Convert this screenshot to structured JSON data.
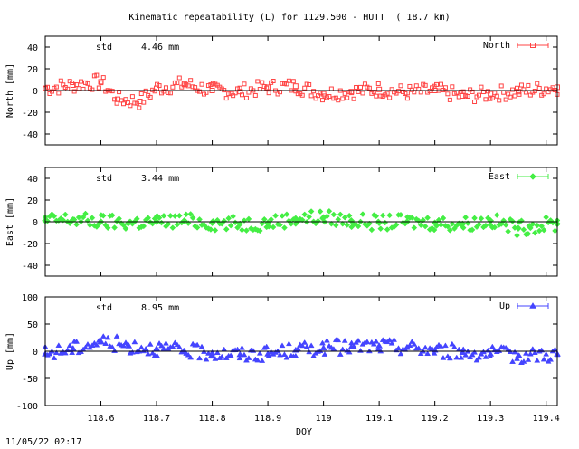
{
  "title": "Kinematic repeatability (L) for 1129.500 - HUTT  ( 18.7 km)",
  "footer_timestamp": "11/05/22 02:17",
  "chart_data": [
    {
      "type": "scatter",
      "series_name": "North",
      "ylabel": "North [mm]",
      "ylim": [
        -50,
        50
      ],
      "yticks": [
        -40,
        -20,
        0,
        20,
        40
      ],
      "std_label": "std",
      "std_value": "4.46 mm",
      "color": "#ff4444",
      "marker": "square",
      "xlim": [
        118.5,
        119.42
      ],
      "x": [
        118.5,
        118.55,
        118.6,
        118.63,
        118.67,
        118.7,
        118.75,
        118.8,
        118.85,
        118.9,
        118.95,
        119.0,
        119.05,
        119.1,
        119.15,
        119.2,
        119.25,
        119.3,
        119.35,
        119.42
      ],
      "y": [
        2,
        5,
        8,
        -8,
        -10,
        2,
        6,
        0,
        -1,
        3,
        4,
        -3,
        -1,
        1,
        -2,
        0,
        -5,
        -3,
        -1,
        3
      ]
    },
    {
      "type": "scatter",
      "series_name": "East",
      "ylabel": "East [mm]",
      "ylim": [
        -50,
        50
      ],
      "yticks": [
        -40,
        -20,
        0,
        20,
        40
      ],
      "std_label": "std",
      "std_value": "3.44 mm",
      "color": "#44ee44",
      "marker": "diamond",
      "xlim": [
        118.5,
        119.42
      ],
      "x": [
        118.5,
        118.55,
        118.6,
        118.65,
        118.7,
        118.75,
        118.8,
        118.85,
        118.9,
        118.95,
        119.0,
        119.05,
        119.1,
        119.15,
        119.2,
        119.25,
        119.3,
        119.35,
        119.37,
        119.42
      ],
      "y": [
        1,
        2,
        0,
        -1,
        0,
        1,
        -1,
        -2,
        -1,
        3,
        4,
        1,
        -1,
        0,
        -1,
        -2,
        1,
        -6,
        -4,
        -2
      ]
    },
    {
      "type": "scatter",
      "series_name": "Up",
      "ylabel": "Up [mm]",
      "ylim": [
        -100,
        100
      ],
      "yticks": [
        -100,
        -50,
        0,
        50,
        100
      ],
      "std_label": "std",
      "std_value": "8.95 mm",
      "color": "#4444ff",
      "marker": "triangle",
      "xlim": [
        118.5,
        119.42
      ],
      "x": [
        118.5,
        118.55,
        118.6,
        118.65,
        118.7,
        118.75,
        118.8,
        118.85,
        118.9,
        118.95,
        119.0,
        119.05,
        119.1,
        119.15,
        119.2,
        119.25,
        119.3,
        119.35,
        119.42
      ],
      "y": [
        -5,
        5,
        18,
        10,
        5,
        0,
        -3,
        -6,
        -5,
        2,
        6,
        8,
        10,
        7,
        2,
        -2,
        -5,
        -8,
        -5
      ],
      "xlabel": "DOY",
      "xticks": [
        118.6,
        118.7,
        118.8,
        118.9,
        119,
        119.1,
        119.2,
        119.3,
        119.4
      ],
      "xtick_labels": [
        "118.6",
        "118.7",
        "118.8",
        "118.9",
        "119",
        "119.1",
        "119.2",
        "119.3",
        "119.4"
      ]
    }
  ]
}
